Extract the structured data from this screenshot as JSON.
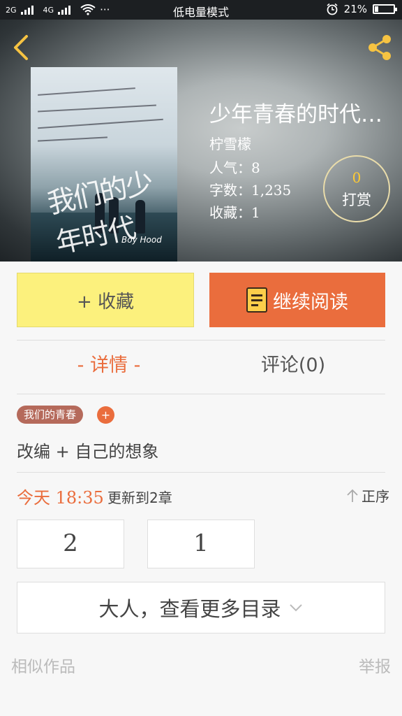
{
  "status_bar": {
    "network_1": "2G",
    "network_2": "4G",
    "network_3": "2G",
    "wifi_icon": "wifi-icon",
    "dots": "···",
    "mode": "低电量模式",
    "battery_percent": "21%",
    "battery_level": 0.21
  },
  "header": {
    "back_icon": "chevron-left-icon",
    "share_icon": "share-icon"
  },
  "book": {
    "title": "少年青春的时代…",
    "author": "柠雪檬",
    "popularity_label": "人气：",
    "popularity": "8",
    "words_label": "字数：",
    "words": "1,235",
    "favorites_label": "收藏：",
    "favorites": "1",
    "cover_title": "我们的少年时代",
    "cover_en": "Boy Hood"
  },
  "reward": {
    "count": "0",
    "label": "打赏"
  },
  "actions": {
    "favorite": "+ 收藏",
    "continue_reading": "继续阅读"
  },
  "tabs": {
    "detail": "- 详情 -",
    "comments": "评论(0)"
  },
  "tags": {
    "tag1": "我们的青春",
    "add": "+"
  },
  "description": "改编 + 自己的想象",
  "update": {
    "time": "今天 18:35",
    "text": "更新到2章",
    "order": "正序"
  },
  "chapters": [
    "2",
    "1"
  ],
  "more_catalog": "大人，查看更多目录",
  "footer": {
    "similar": "相似作品",
    "report": "举报"
  },
  "colors": {
    "accent": "#ea6d3d",
    "favorite_bg": "#fcf17d",
    "reward_number": "#ffcb33"
  }
}
